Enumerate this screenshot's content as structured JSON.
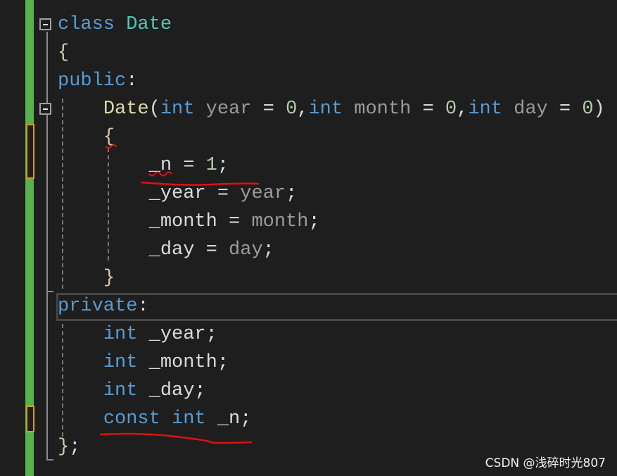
{
  "editor": {
    "lines": [
      [
        [
          "kw",
          "class "
        ],
        [
          "ty",
          "Date"
        ]
      ],
      [
        [
          "br",
          "{"
        ]
      ],
      [
        [
          "kw",
          "public"
        ],
        [
          "pl",
          ":"
        ]
      ],
      [
        [
          "pl",
          "    "
        ],
        [
          "fn",
          "Date"
        ],
        [
          "pl",
          "("
        ],
        [
          "kw",
          "int"
        ],
        [
          "pa",
          " year"
        ],
        [
          "pl",
          " = "
        ],
        [
          "nu",
          "0"
        ],
        [
          "pl",
          ","
        ],
        [
          "kw",
          "int"
        ],
        [
          "pa",
          " month"
        ],
        [
          "pl",
          " = "
        ],
        [
          "nu",
          "0"
        ],
        [
          "pl",
          ","
        ],
        [
          "kw",
          "int"
        ],
        [
          "pa",
          " day"
        ],
        [
          "pl",
          " = "
        ],
        [
          "nu",
          "0"
        ],
        [
          "pl",
          ")"
        ]
      ],
      [
        [
          "pl",
          "    "
        ],
        [
          "br",
          "{"
        ]
      ],
      [
        [
          "pl",
          "        _n = "
        ],
        [
          "nu",
          "1"
        ],
        [
          "pl",
          ";"
        ]
      ],
      [
        [
          "pl",
          "        _year = "
        ],
        [
          "pa",
          "year"
        ],
        [
          "pl",
          ";"
        ]
      ],
      [
        [
          "pl",
          "        _month = "
        ],
        [
          "pa",
          "month"
        ],
        [
          "pl",
          ";"
        ]
      ],
      [
        [
          "pl",
          "        _day = "
        ],
        [
          "pa",
          "day"
        ],
        [
          "pl",
          ";"
        ]
      ],
      [
        [
          "pl",
          "    "
        ],
        [
          "br",
          "}"
        ]
      ],
      [
        [
          "kw",
          "private"
        ],
        [
          "pl",
          ":"
        ]
      ],
      [
        [
          "pl",
          "    "
        ],
        [
          "kw",
          "int"
        ],
        [
          "pl",
          " _year;"
        ]
      ],
      [
        [
          "pl",
          "    "
        ],
        [
          "kw",
          "int"
        ],
        [
          "pl",
          " _month;"
        ]
      ],
      [
        [
          "pl",
          "    "
        ],
        [
          "kw",
          "int"
        ],
        [
          "pl",
          " _day;"
        ]
      ],
      [
        [
          "pl",
          "    "
        ],
        [
          "kw",
          "const"
        ],
        [
          "pl",
          " "
        ],
        [
          "kw",
          "int"
        ],
        [
          "pl",
          " _n;"
        ]
      ],
      [
        [
          "br",
          "}"
        ],
        [
          "pl",
          ";"
        ]
      ]
    ],
    "colors": {
      "keyword": "#569cd6",
      "type": "#4ec9b0",
      "function": "#dcdcaa",
      "parameter": "#9a9a9a",
      "number": "#b5cea8",
      "change_bar": "#57b24e",
      "annotation": "#e01010"
    }
  },
  "watermark": "CSDN @浅碎时光807"
}
